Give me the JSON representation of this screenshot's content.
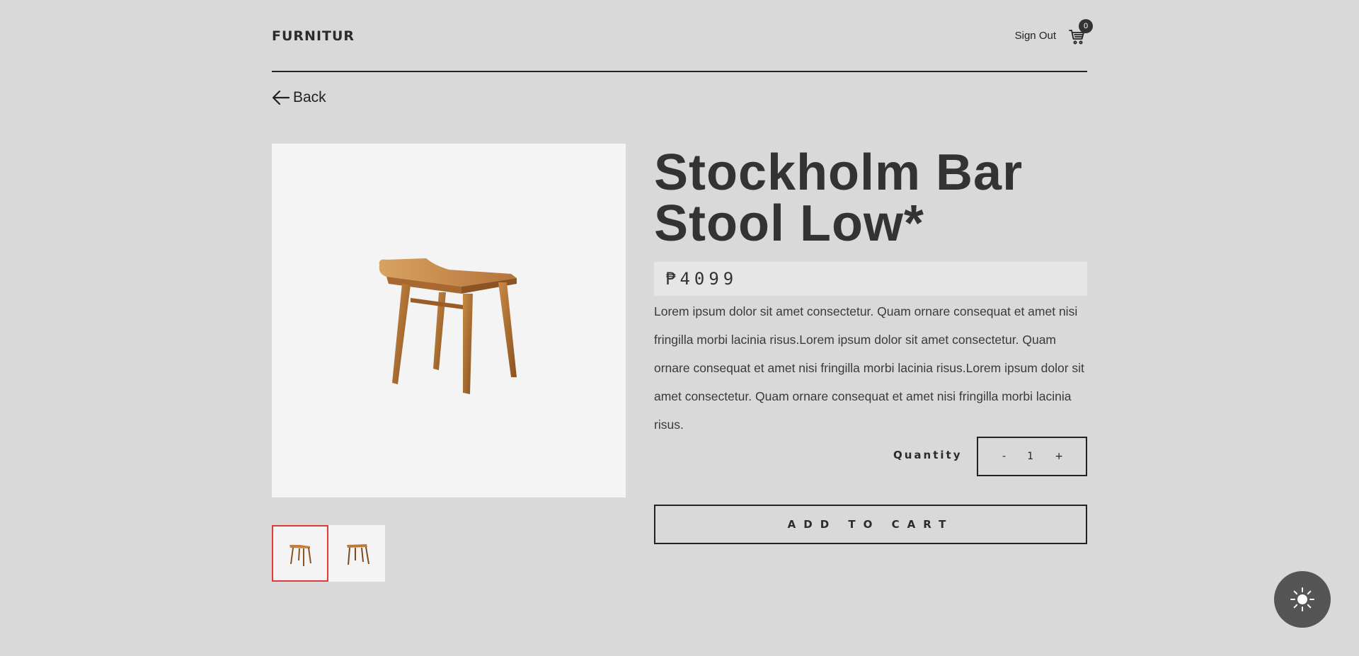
{
  "brand": {
    "logo": "FURNITUR"
  },
  "header": {
    "sign_out": "Sign Out",
    "cart_count": "0",
    "cart_icon": "cart-icon"
  },
  "nav": {
    "back_label": "Back",
    "back_icon": "arrow-left-icon"
  },
  "product": {
    "title": "Stockholm Bar Stool Low*",
    "price": "₱4099",
    "description": "Lorem ipsum dolor sit amet consectetur. Quam ornare consequat et amet nisi fringilla morbi lacinia risus.Lorem ipsum dolor sit amet consectetur. Quam ornare consequat et amet nisi fringilla morbi lacinia risus.Lorem ipsum dolor sit amet consectetur. Quam ornare consequat et amet nisi fringilla morbi lacinia risus.",
    "thumbnails": [
      "thumbnail-1",
      "thumbnail-2"
    ],
    "selected_thumbnail": 0
  },
  "quantity": {
    "label": "Quantity",
    "minus": "-",
    "value": "1",
    "plus": "+"
  },
  "actions": {
    "add_to_cart": "ADD TO CART"
  },
  "theme_toggle": {
    "icon": "sun-icon"
  },
  "colors": {
    "background": "#d9d9d9",
    "panel": "#f4f4f4",
    "text": "#333333",
    "selected_thumbnail_border": "#e03a3a",
    "toggle_bg": "#555555"
  }
}
